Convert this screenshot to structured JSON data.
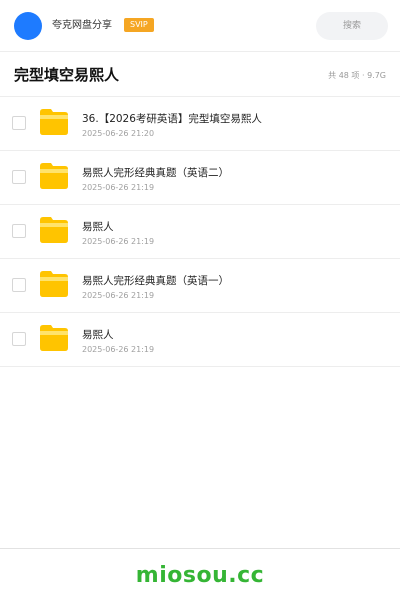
{
  "header": {
    "app_name": "夸克网盘分享",
    "badge": "SVIP",
    "search_label": "搜索",
    "avatar_color": "#1e7bff",
    "badge_color": "#f5a623"
  },
  "title_bar": {
    "title": "完型填空易熙人",
    "summary": "共 48 项 · 9.7G"
  },
  "files": [
    {
      "name": "36.【2026考研英语】完型填空易熙人",
      "date": "2025-06-26 21:20",
      "icon": "folder-icon"
    },
    {
      "name": "易熙人完形经典真题（英语二）",
      "date": "2025-06-26 21:19",
      "icon": "folder-icon"
    },
    {
      "name": "易熙人",
      "date": "2025-06-26 21:19",
      "icon": "folder-icon"
    },
    {
      "name": "易熙人完形经典真题（英语一）",
      "date": "2025-06-26 21:19",
      "icon": "folder-icon"
    },
    {
      "name": "易熙人",
      "date": "2025-06-26 21:19",
      "icon": "folder-icon"
    }
  ],
  "footer": {
    "brand": "miosou.cc",
    "brand_color": "#35b535"
  }
}
